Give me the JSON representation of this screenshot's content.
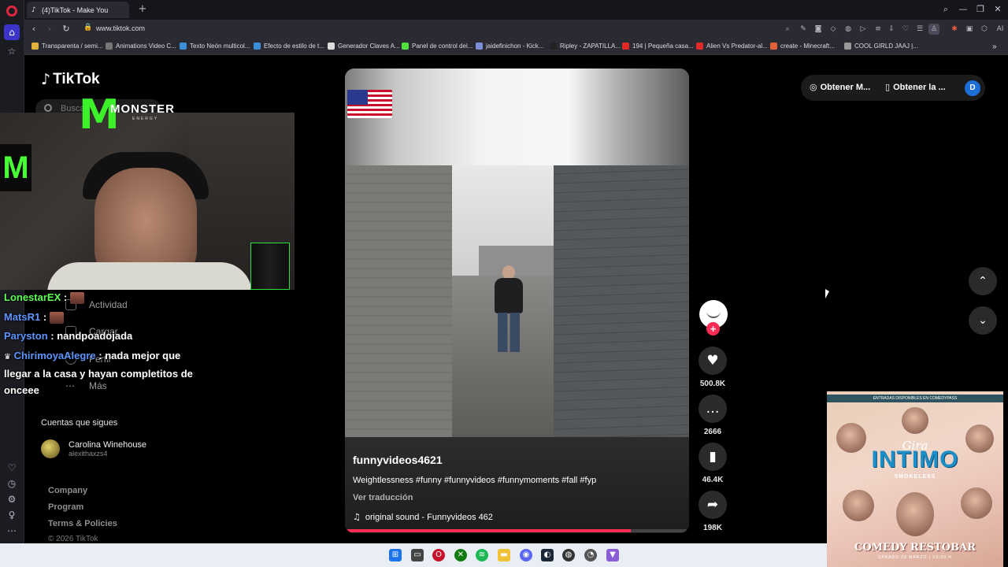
{
  "browser": {
    "tab_title": "(4)TikTok - Make You",
    "new_tab_symbol": "+",
    "url": "www.tiktok.com",
    "win_controls": [
      "⌕",
      "—",
      "❐",
      "✕"
    ]
  },
  "bookmarks": [
    "Transparenta / semi...",
    "Animations Video C...",
    "Texto Neón multicol...",
    "Efecto de estilo de t...",
    "Generador Claves A...",
    "Panel de control del...",
    "jaidefinichon - Kick...",
    "Ripley - ZAPATILLA...",
    "194 | Pequeña casa...",
    "Alien Vs Predator-al...",
    "create - Minecraft...",
    "COOL GIRLD JAAJ |..."
  ],
  "tiktok": {
    "logo": "TikTok",
    "search_placeholder": "Buscar",
    "nav": {
      "activity": "Actividad",
      "upload": "Cargar",
      "profile": "Perfil",
      "more": "Más"
    },
    "following_title": "Cuentas que sigues",
    "following_account": {
      "name": "Carolina Winehouse",
      "handle": "alexithaxzs4"
    },
    "footer": {
      "company": "Company",
      "program": "Program",
      "terms": "Terms & Policies",
      "copyright": "© 2026 TikTok"
    },
    "top_right": {
      "get_coins": "Obtener M...",
      "get_app": "Obtener la ...",
      "avatar_letter": "D"
    }
  },
  "video": {
    "username": "funnyvideos4621",
    "description": "Weightlessness #funny #funnyvideos #funnymoments #fall #fyp",
    "translate": "Ver traducción",
    "sound": "original sound - Funnyvideos 462",
    "progress": 0.83,
    "likes": "500.8K",
    "comments": "2666",
    "saves": "46.4K",
    "shares": "198K"
  },
  "stream_overlay": {
    "monster_text": "MONSTER",
    "monster_sub": "ENERGY",
    "chat": [
      {
        "user": "LonestarEX",
        "message": ""
      },
      {
        "user": "MatsR1",
        "message": ""
      },
      {
        "user": "Paryston",
        "message": "nandpoadojada"
      },
      {
        "user": "ChirimoyaAlegre",
        "message": "nada mejor que llegar a la casa y hayan completitos de onceee"
      }
    ]
  },
  "poster": {
    "top_text": "ENTRADAS DISPONIBLES EN COMEDYPASS",
    "gira": "Gira",
    "title": "INTIMO",
    "artist": "SMOKELESS",
    "venue": "COMEDY RESTOBAR",
    "date": "SÁBADO 28 MARZO | 19:00 H"
  }
}
